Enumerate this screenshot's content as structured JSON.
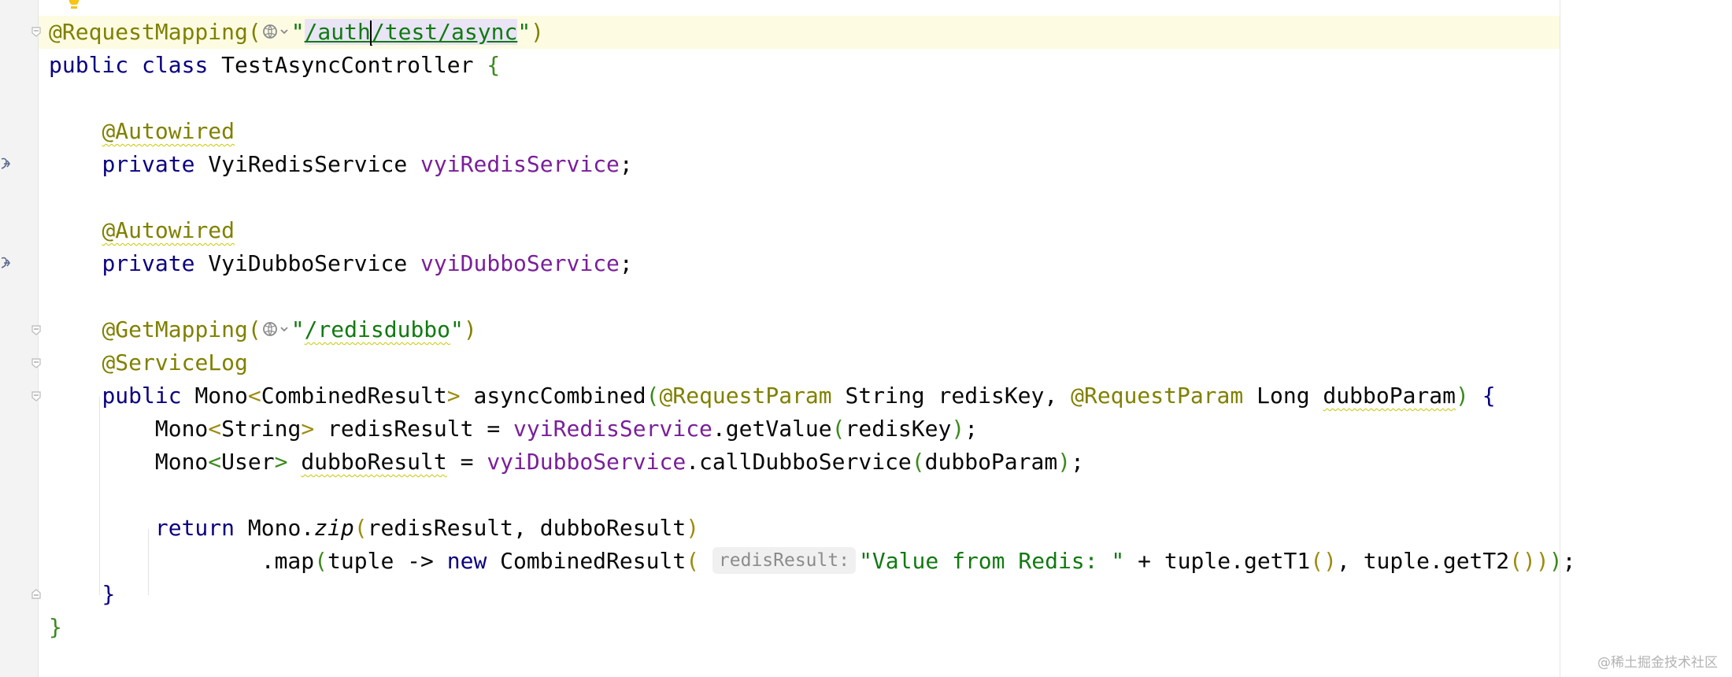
{
  "code": {
    "l1": {
      "annotation": "@RequestMapping(",
      "quote_open": "\"",
      "url_part1": "/auth",
      "url_part2": "/test/async",
      "quote_close": "\"",
      "paren_close": ")"
    },
    "l2": {
      "kw_public": "public",
      "kw_class": "class",
      "class_name": "TestAsyncController",
      "brace_open": "{"
    },
    "l4": {
      "annotation": "@Autowired"
    },
    "l5": {
      "kw_private": "private",
      "type": "VyiRedisService",
      "field": "vyiRedisService",
      "semicolon": ";"
    },
    "l7": {
      "annotation": "@Autowired"
    },
    "l8": {
      "kw_private": "private",
      "type": "VyiDubboService",
      "field": "vyiDubboService",
      "semicolon": ";"
    },
    "l10": {
      "annotation": "@GetMapping(",
      "quote_open": "\"",
      "url": "/redisdubbo",
      "quote_close": "\"",
      "paren_close": ")"
    },
    "l11": {
      "annotation": "@ServiceLog"
    },
    "l12": {
      "kw_public": "public",
      "mono": "Mono",
      "lt": "<",
      "generic": "CombinedResult",
      "gt": ">",
      "method": "asyncCombined",
      "paren_open": "(",
      "ann1": "@RequestParam",
      "param1_type": "String",
      "param1_name": "redisKey,",
      "ann2": "@RequestParam",
      "param2_type": "Long",
      "param2_name": "dubboParam",
      "paren_close": ")",
      "brace_open": "{"
    },
    "l13": {
      "mono": "Mono",
      "lt": "<",
      "generic": "String",
      "gt": ">",
      "var": "redisResult",
      "eq": "=",
      "field": "vyiRedisService",
      "call": ".getValue",
      "paren_open": "(",
      "arg": "redisKey",
      "paren_close": ")",
      "semicolon": ";"
    },
    "l14": {
      "mono": "Mono",
      "lt": "<",
      "generic": "User",
      "gt": ">",
      "var": "dubboResult",
      "eq": "=",
      "field": "vyiDubboService",
      "call": ".callDubboService",
      "paren_open": "(",
      "arg": "dubboParam",
      "paren_close": ")",
      "semicolon": ";"
    },
    "l16": {
      "kw_return": "return",
      "mono_zip": "Mono.",
      "zip": "zip",
      "paren_open": "(",
      "args": "redisResult, dubboResult",
      "paren_close": ")"
    },
    "l17": {
      "map": ".map",
      "paren_open": "(",
      "lambda": "tuple ->",
      "kw_new": "new",
      "ctor": "CombinedResult",
      "ctor_paren": "(",
      "hint": "redisResult:",
      "str": "\"Value from Redis: \"",
      "plus": "+",
      "t1": "tuple.getT1",
      "t1_parens": "()",
      "comma": ",",
      "t2": "tuple.getT2",
      "t2_parens": "()",
      "close_ctor": ")",
      "close_map": ")",
      "semicolon": ";"
    },
    "l18": {
      "brace_close": "}"
    },
    "l19": {
      "brace_close": "}"
    }
  },
  "icons": {
    "bulb": "lightbulb-icon",
    "globe": "globe-icon",
    "bean": "spring-bean-icon",
    "fold": "fold-marker-icon"
  },
  "colors": {
    "annotation": "#808000",
    "keyword": "#0a0080",
    "field": "#7a1f9a",
    "string": "#117a11",
    "current_line": "#fdfce3"
  },
  "watermark": "@稀土掘金技术社区"
}
